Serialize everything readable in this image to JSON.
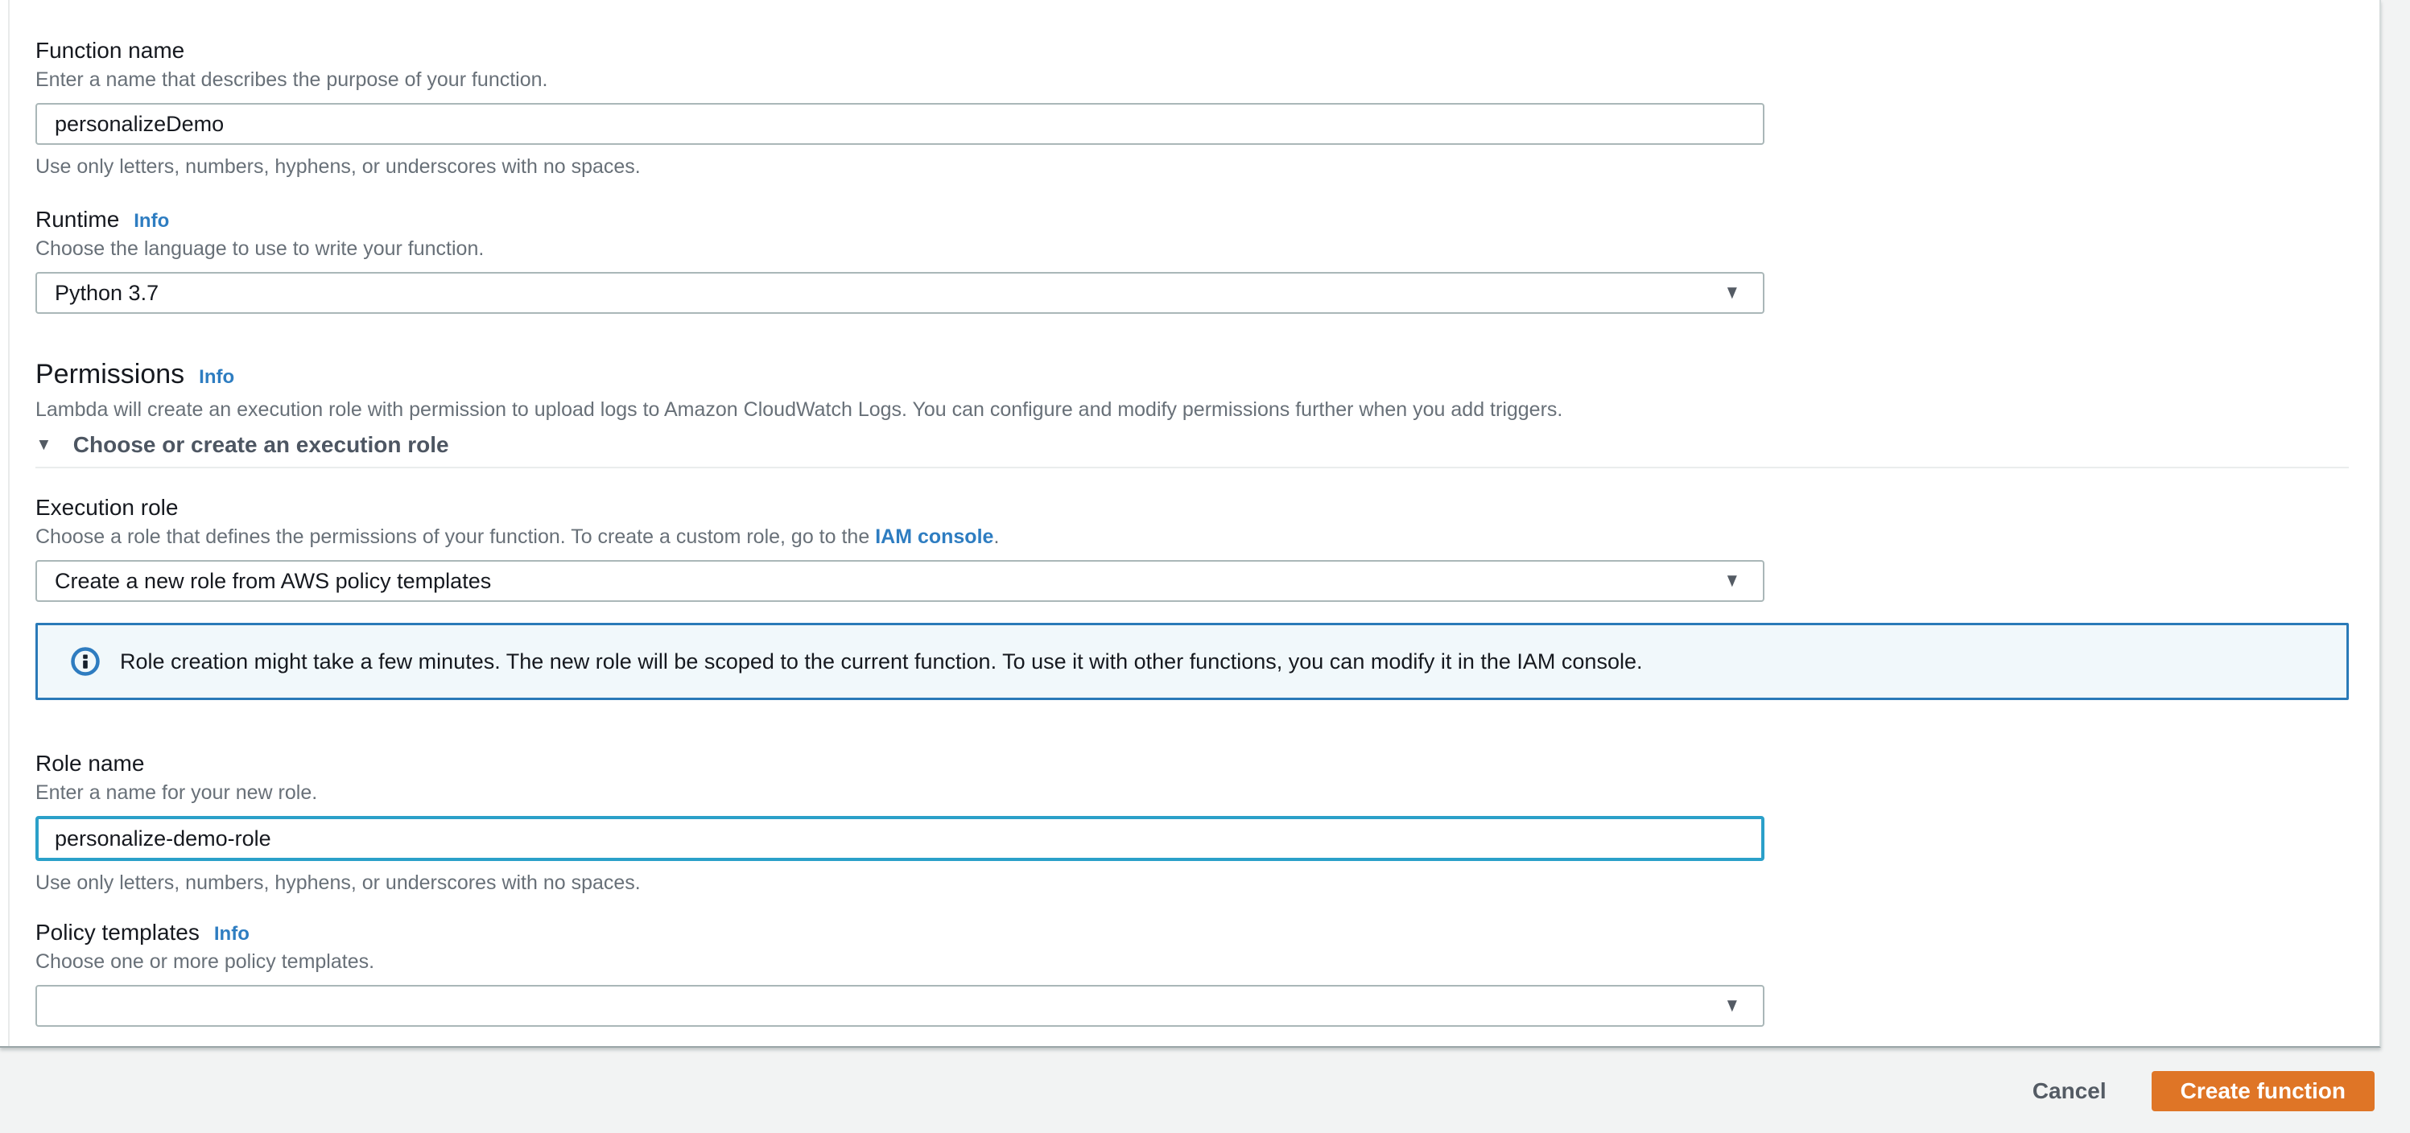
{
  "colors": {
    "page_background": "#f2f3f3",
    "card_background": "#ffffff",
    "accent_orange": "#df7526",
    "link_blue": "#2e7dc1",
    "alert_border_blue": "#2a7ab8",
    "alert_background": "#f1f8fb",
    "focus_border": "#2ba0c9",
    "input_border": "#aab7b8",
    "text_dark": "#16191f",
    "text_muted": "#687078"
  },
  "icons": {
    "caret_down": "▼",
    "triangle_down": "▼",
    "info_circle": "info-circle"
  },
  "form": {
    "function_name": {
      "label": "Function name",
      "description": "Enter a name that describes the purpose of your function.",
      "value": "personalizeDemo",
      "helper": "Use only letters, numbers, hyphens, or underscores with no spaces."
    },
    "runtime": {
      "label": "Runtime",
      "info_label": "Info",
      "description": "Choose the language to use to write your function.",
      "value": "Python 3.7"
    },
    "permissions": {
      "heading": "Permissions",
      "info_label": "Info",
      "description": "Lambda will create an execution role with permission to upload logs to Amazon CloudWatch Logs. You can configure and modify permissions further when you add triggers.",
      "expander_label": "Choose or create an execution role"
    },
    "execution_role": {
      "label": "Execution role",
      "description_prefix": "Choose a role that defines the permissions of your function. To create a custom role, go to the ",
      "link_text": "IAM console",
      "description_suffix": ".",
      "value": "Create a new role from AWS policy templates"
    },
    "role_alert": {
      "text": "Role creation might take a few minutes. The new role will be scoped to the current function. To use it with other functions, you can modify it in the IAM console."
    },
    "role_name": {
      "label": "Role name",
      "description": "Enter a name for your new role.",
      "value": "personalize-demo-role",
      "helper": "Use only letters, numbers, hyphens, or underscores with no spaces."
    },
    "policy_templates": {
      "label": "Policy templates",
      "info_label": "Info",
      "description": "Choose one or more policy templates.",
      "value": ""
    }
  },
  "footer": {
    "cancel_label": "Cancel",
    "submit_label": "Create function"
  }
}
